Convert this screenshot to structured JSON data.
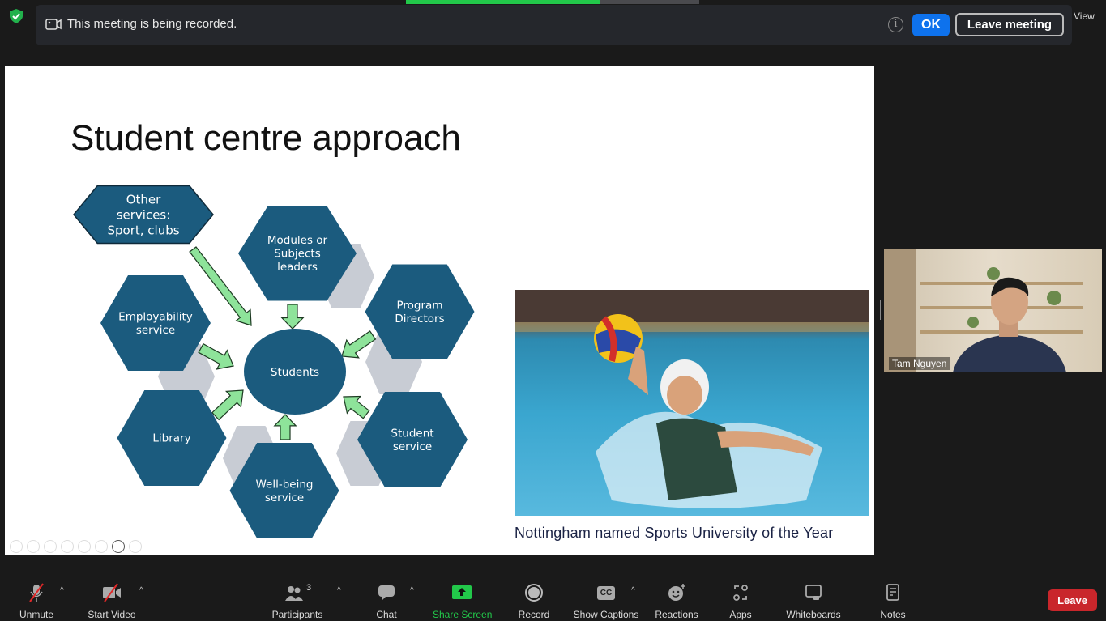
{
  "banner": {
    "message": "This meeting is being recorded.",
    "info_icon": "i",
    "ok_label": "OK",
    "leave_label": "Leave meeting"
  },
  "view_label": "View",
  "share_progress": 0.66,
  "slide": {
    "title": "Student centre approach",
    "center_label": "Students",
    "nodes": [
      "Other services: Sport, clubs",
      "Modules or Subjects leaders",
      "Program Directors",
      "Employability service",
      "Library",
      "Well-being service",
      "Student service"
    ],
    "node_lines": [
      [
        "Other",
        "services:",
        "Sport, clubs"
      ],
      [
        "Modules or",
        "Subjects",
        "leaders"
      ],
      [
        "Program",
        "Directors"
      ],
      [
        "Employability",
        "service"
      ],
      [
        "Library"
      ],
      [
        "Well-being",
        "service"
      ],
      [
        "Student",
        "service"
      ]
    ],
    "caption": "Nottingham named Sports University of the Year",
    "colors": {
      "hexagon": "#1b5b7e",
      "shadow": "#c8ccd4",
      "arrow": "#8ee39a"
    }
  },
  "participant": {
    "name": "Tam Nguyen"
  },
  "toolbar": {
    "unmute": "Unmute",
    "start_video": "Start Video",
    "participants": "Participants",
    "participants_count": "3",
    "chat": "Chat",
    "share_screen": "Share Screen",
    "record": "Record",
    "show_captions": "Show Captions",
    "captions_icon": "CC",
    "reactions": "Reactions",
    "apps": "Apps",
    "whiteboards": "Whiteboards",
    "notes": "Notes",
    "leave": "Leave"
  }
}
